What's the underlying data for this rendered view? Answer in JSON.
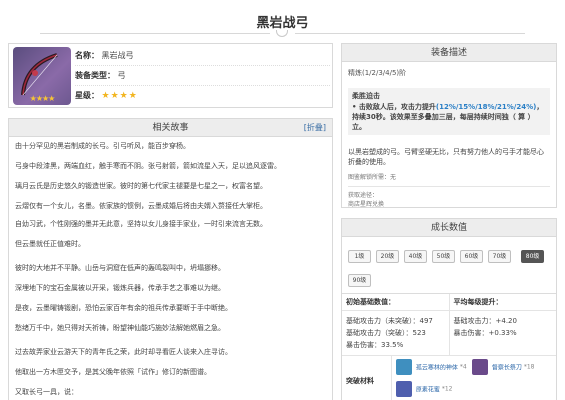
{
  "page_title": "黑岩战弓",
  "info": {
    "name_label": "名称：",
    "name_value": "黑岩战弓",
    "type_label": "装备类型：",
    "type_value": "弓",
    "rank_label": "星级：",
    "stars": "★★★★",
    "icon": "bow-icon"
  },
  "story": {
    "header": "相关故事",
    "fold": "[折叠]",
    "paragraphs": [
      "由十分罕见的黑岩制成的长弓。引弓听风，能百步穿杨。",
      "弓身中段漆黑，两端血红，触手寒而不阴。张弓射箭，箭如流星入天，足以追风逐雷。",
      "璃月云氏是历史悠久的锻造世家。彼时的第七代家主褪要是七星之一，权富名望。",
      "云熠仅有一个女儿，名墨。依家族的惯例，云墨成婚后将由夫婿入赘接任大掌柜。",
      "自幼习武，个性刚强的墨并无此意，坚持以女儿身接手家业，一时引来流言无数。",
      "但云墨就任正值难时。",
      "彼时的大地并不平静。山岳与洞窟在低声的轰鸣裂叫中，坍塌挪移。",
      "深埋地下的宝石金属被以开采，锻炼兵器，传承手艺之事难以为继。",
      "是夜，云墨曜铸锻剧，恐怕云家百年有余的祖兵传承要断于手中断绝。",
      "愁绪万千中，她只得对天祈祷，盼望神仙能巧施妙法解她燃眉之急。",
      "过去故弄家业云游天下的青年氏之荣，此时却寻看匠人谈来入庄寻访。",
      "他取出一方木匣交予，是其父晚年依照「试作」修订的新图谱。",
      "又取长弓一具，说："
    ]
  },
  "desc": {
    "header": "装备描述",
    "refine": "精炼(1/2/3/4/5)阶",
    "effect_title": "柔胜迫击",
    "effect_pre": "• 击败敌人后，攻击力提升",
    "effect_values": "(12%/15%/18%/21%/24%)",
    "effect_mid": "，持续30秒。该效果至多叠加三层，每层持续时间独（ 算 ）立。",
    "flavor": "以黑岩塑成的弓。弓臂坚硬无比，只有努力他人的弓手才能尽心折叠的使用。",
    "obtain_label": "图鉴解锁所需：无",
    "source_label": "获取途径：",
    "source_value": "商店星辉兑换"
  },
  "growth": {
    "header": "成长数值",
    "levels": [
      "1级",
      "20级",
      "40级",
      "50级",
      "60级",
      "70级",
      "80级",
      "90级"
    ],
    "active_level": "80级",
    "base_head": "初始基础数值：",
    "avg_head": "平均每级提升：",
    "base_stats": [
      "基础攻击力（未突破）：497",
      "基础攻击力（突破）：523",
      "暴击伤害：33.5%"
    ],
    "avg_stats": [
      "基础攻击力：+4.20",
      "暴击伤害：+0.33%"
    ],
    "mats_label": "突破材料",
    "mats": [
      {
        "name": "孤云寒林的神体",
        "count": "*4",
        "color": "#3f8fbf",
        "icon": "material-icon"
      },
      {
        "name": "督察长祭刀",
        "count": "*18",
        "color": "#6a4a8a",
        "icon": "material-icon"
      },
      {
        "name": "原素花蜜",
        "count": "*12",
        "color": "#4f5fae",
        "icon": "material-icon"
      }
    ]
  }
}
